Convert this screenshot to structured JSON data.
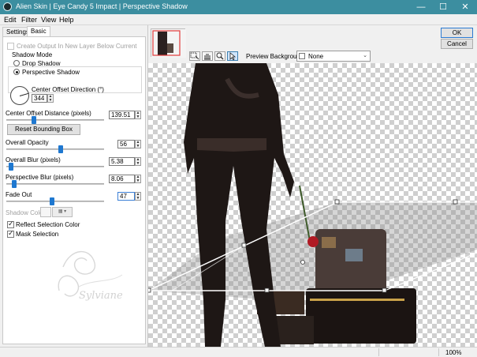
{
  "window": {
    "title": "Alien Skin | Eye Candy 5 Impact | Perspective Shadow",
    "minimize_glyph": "—",
    "maximize_glyph": "☐",
    "close_glyph": "✕"
  },
  "menu": {
    "edit": "Edit",
    "filter": "Filter",
    "view": "View",
    "help": "Help"
  },
  "tabs": {
    "settings": "Settings",
    "basic": "Basic"
  },
  "basic": {
    "create_output_label": "Create Output In New Layer Below Current",
    "shadow_mode": {
      "title": "Shadow Mode",
      "drop": "Drop Shadow",
      "perspective": "Perspective Shadow",
      "selected": "Perspective Shadow"
    },
    "direction": {
      "label": "Center Offset Direction (°)",
      "value": "344"
    },
    "distance": {
      "label": "Center Offset Distance (pixels)",
      "value": "139.51",
      "level": 0.28
    },
    "reset_button": "Reset Bounding Box",
    "opacity": {
      "label": "Overall Opacity",
      "value": "56",
      "level": 0.56
    },
    "overall_blur": {
      "label": "Overall Blur (pixels)",
      "value": "5.38",
      "level": 0.05
    },
    "perspective_blur": {
      "label": "Perspective Blur (pixels)",
      "value": "8.06",
      "level": 0.08
    },
    "fade_out": {
      "label": "Fade Out",
      "value": "47",
      "level": 0.47
    },
    "shadow_color_label": "Shadow Color",
    "reflect_label": "Reflect Selection Color",
    "mask_label": "Mask Selection"
  },
  "watermark_text": "Sylviane",
  "preview": {
    "background_label": "Preview Background:",
    "background_value": "None",
    "tool_icons": [
      "select-box-icon",
      "hand-icon",
      "zoom-icon",
      "pointer-icon"
    ]
  },
  "buttons": {
    "ok": "OK",
    "cancel": "Cancel"
  },
  "status": {
    "zoom": "100%"
  },
  "colors": {
    "titlebar": "#3c8ea0",
    "accent": "#1f78d0"
  }
}
